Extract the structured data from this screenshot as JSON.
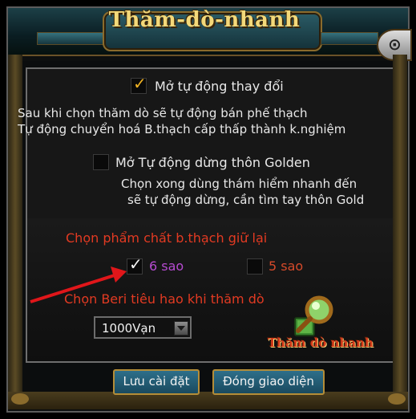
{
  "window": {
    "title": "Thăm-dò-nhanh",
    "close_icon": "camera-close-icon"
  },
  "auto_change": {
    "checked": true,
    "label": "Mở tự động thay đổi",
    "desc_line1": "Sau khi chọn thăm dò sẽ tự động bán phế thạch",
    "desc_line2": "Tự động chuyển hoá B.thạch cấp thấp thành k.nghiệm"
  },
  "auto_stop": {
    "checked": false,
    "label": "Mở Tự động dừng thôn Golden",
    "desc_line1": "Chọn xong dùng thám hiểm nhanh đến",
    "desc_line2": "sẽ tự động dừng, cần tìm tay thôn Gold"
  },
  "quality": {
    "heading": "Chọn phẩm chất b.thạch giữ lại",
    "options": [
      {
        "label": "6 sao",
        "checked": true,
        "color": "#b64bd1"
      },
      {
        "label": "5 sao",
        "checked": false,
        "color": "#d54a2a"
      }
    ]
  },
  "beri": {
    "heading": "Chọn Beri tiêu hao khi thăm dò",
    "selected": "1000Vạn"
  },
  "quick_explore": {
    "label": "Thăm dò nhanh",
    "icon": "magnifier-icon"
  },
  "buttons": {
    "save": "Lưu cài đặt",
    "close": "Đóng giao diện"
  },
  "colors": {
    "accent_red": "#e23a22",
    "title_gold": "#f3d97a",
    "button_blue": "#2e6f8a"
  }
}
